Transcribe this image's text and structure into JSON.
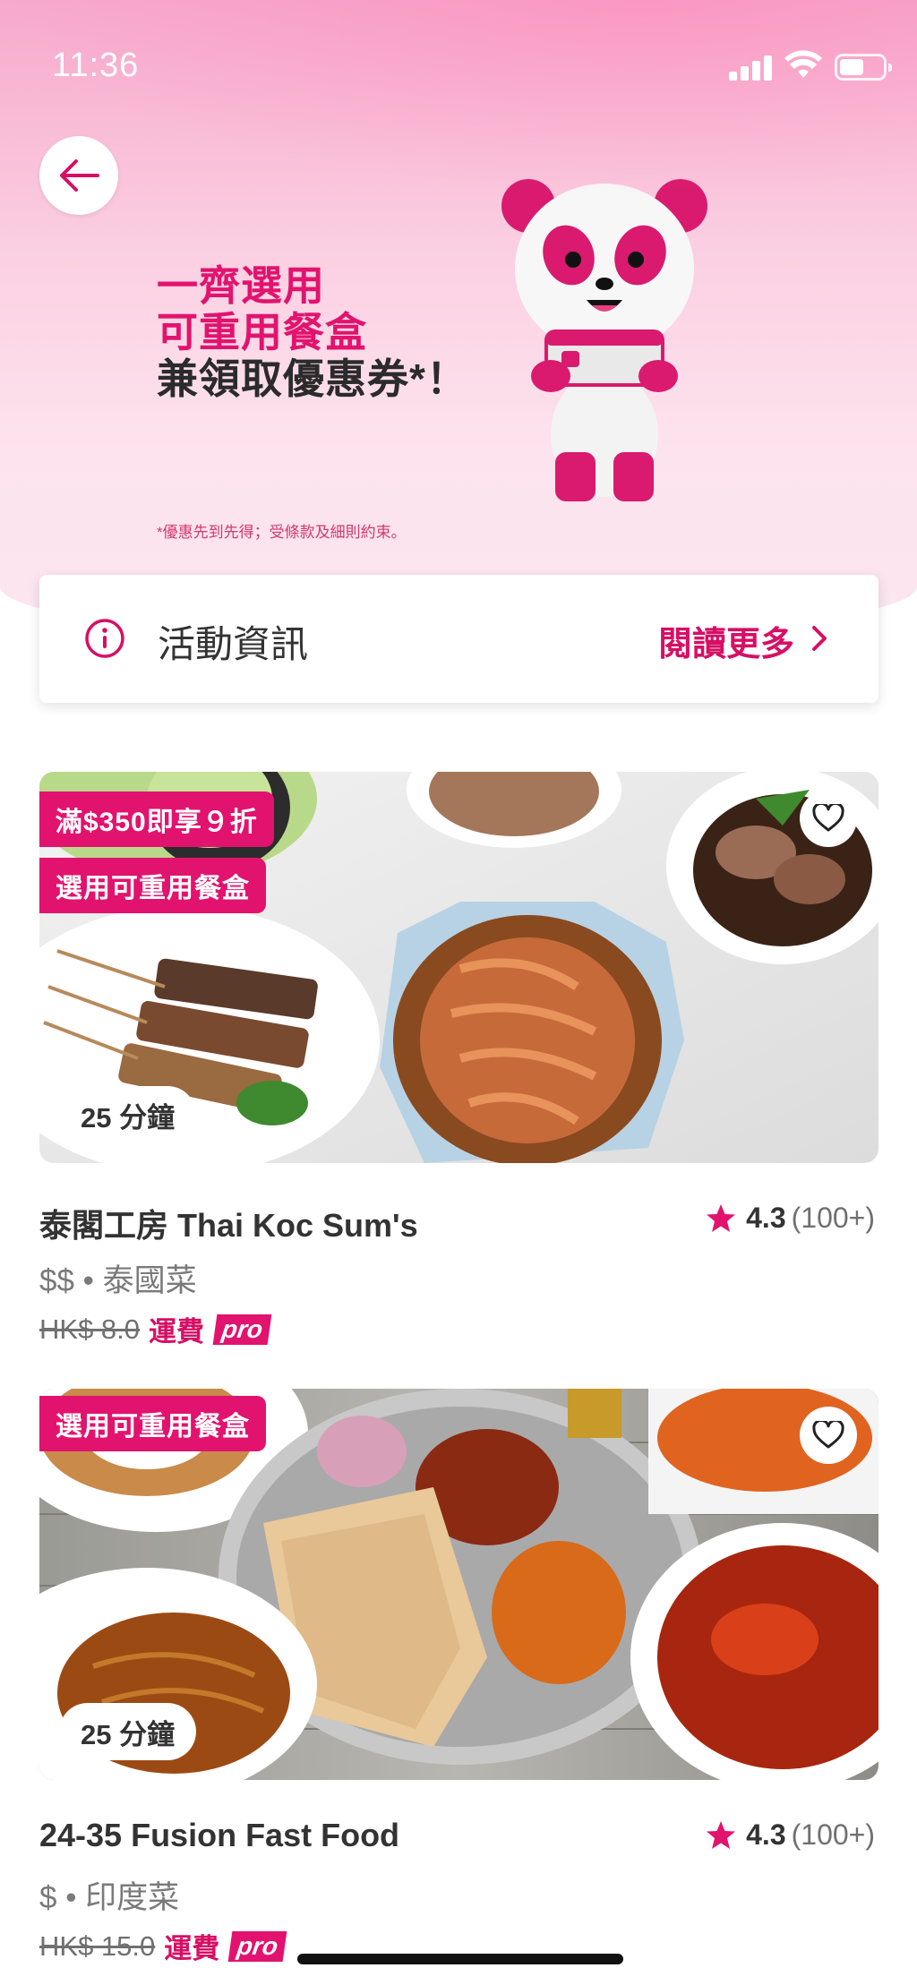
{
  "status_bar": {
    "time": "11:36"
  },
  "hero": {
    "line1": "一齊選用",
    "line2": "可重用餐盒",
    "line3": "兼領取優惠券*！",
    "note": "*優惠先到先得；受條款及細則約束。"
  },
  "info_card": {
    "title": "活動資訊",
    "more": "閱讀更多"
  },
  "restaurants": [
    {
      "tags": [
        "滿$350即享９折",
        "選用可重用餐盒"
      ],
      "time": "25 分鐘",
      "name": "泰閣工房 Thai Koc Sum's",
      "rating": "4.3",
      "rating_count": "(100+)",
      "meta": "$$ • 泰國菜",
      "fee_old": "HK$ 8.0",
      "fee_label": "運費",
      "pro": "pro"
    },
    {
      "tags": [
        "選用可重用餐盒"
      ],
      "time": "25 分鐘",
      "name": "24-35 Fusion Fast Food",
      "rating": "4.3",
      "rating_count": "(100+)",
      "meta": "$ • 印度菜",
      "fee_old": "HK$ 15.0",
      "fee_label": "運費",
      "pro": "pro"
    }
  ],
  "colors": {
    "brand": "#e2136e",
    "accent_text": "#d70f64"
  },
  "icons": [
    "arrow-left-icon",
    "info-icon",
    "chevron-right-icon",
    "heart-icon",
    "star-icon",
    "signal-icon",
    "wifi-icon",
    "battery-icon"
  ]
}
